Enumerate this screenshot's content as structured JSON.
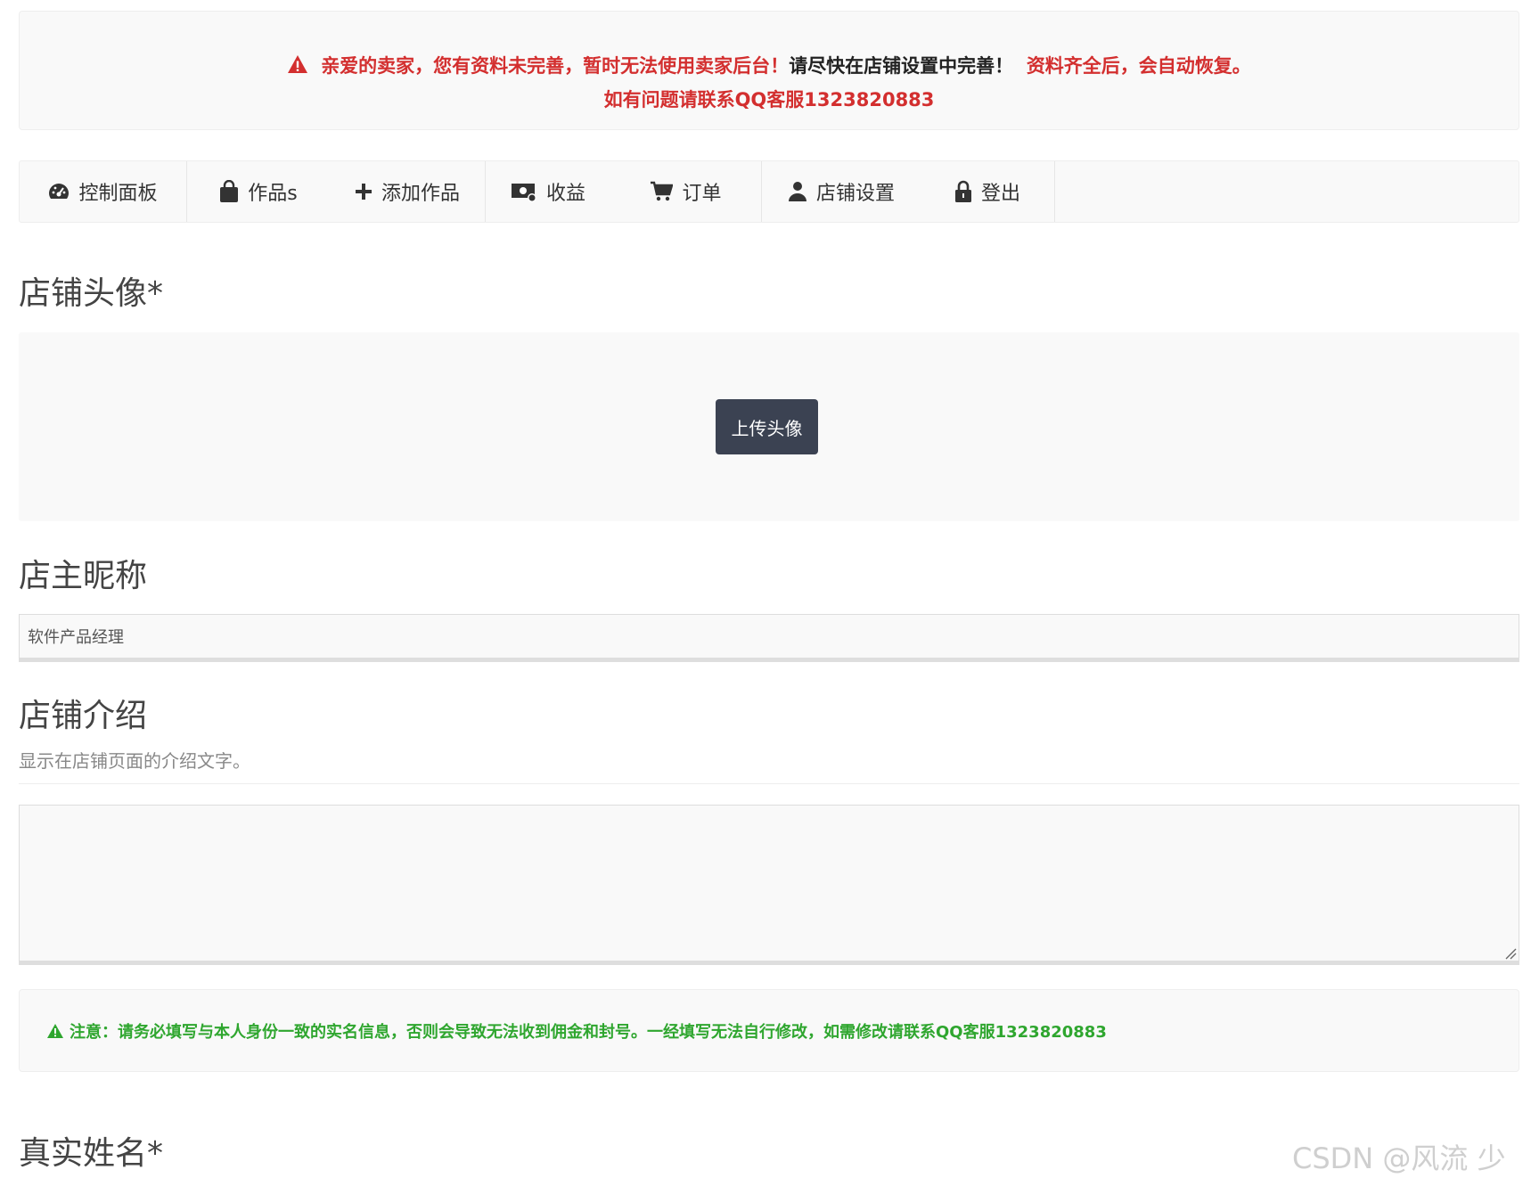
{
  "alert": {
    "line1_red_a": "亲爱的卖家，您有资料未完善，暂时无法使用卖家后台！",
    "line1_dark": "请尽快在店铺设置中完善！",
    "line1_red_b": "资料齐全后，会自动恢复。",
    "line2": "如有问题请联系QQ客服1323820883",
    "color_red": "#d32f2f"
  },
  "nav": {
    "items": [
      {
        "label": "控制面板",
        "icon": "dashboard-icon"
      },
      {
        "label": "作品s",
        "icon": "shopping-bag-icon"
      },
      {
        "label": "添加作品",
        "icon": "plus-icon"
      },
      {
        "label": "收益",
        "icon": "money-icon"
      },
      {
        "label": "订单",
        "icon": "cart-icon"
      },
      {
        "label": "店铺设置",
        "icon": "user-icon"
      },
      {
        "label": "登出",
        "icon": "lock-icon"
      }
    ]
  },
  "avatar": {
    "title": "店铺头像*",
    "upload_label": "上传头像"
  },
  "nickname": {
    "title": "店主昵称",
    "value": "软件产品经理"
  },
  "intro": {
    "title": "店铺介绍",
    "description": "显示在店铺页面的介绍文字。",
    "value": ""
  },
  "notice": {
    "text": "注意：请务必填写与本人身份一致的实名信息，否则会导致无法收到佣金和封号。一经填写无法自行修改，如需修改请联系QQ客服1323820883",
    "color": "#2fa62f"
  },
  "realname": {
    "title": "真实姓名*"
  },
  "watermark": "CSDN @风流 少年"
}
